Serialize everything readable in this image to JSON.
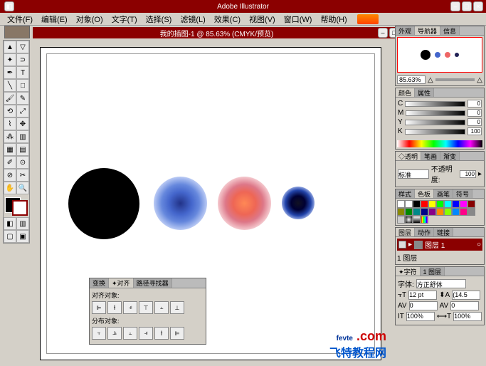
{
  "app": {
    "title": "Adobe Illustrator"
  },
  "menu": {
    "items": [
      "文件(F)",
      "编辑(E)",
      "对象(O)",
      "文字(T)",
      "选择(S)",
      "滤镜(L)",
      "效果(C)",
      "视图(V)",
      "窗口(W)",
      "帮助(H)"
    ]
  },
  "doc": {
    "title": "我的插图-1 @ 85.63% (CMYK/预览)"
  },
  "nav": {
    "tabs": [
      "外观",
      "导航器",
      "信息"
    ],
    "zoom": "85.63%"
  },
  "color": {
    "tabs": [
      "颜色",
      "属性"
    ],
    "channels": [
      "C",
      "M",
      "Y",
      "K"
    ],
    "vals": [
      "0",
      "0",
      "0",
      "100"
    ]
  },
  "trans": {
    "tabs": [
      "◇透明",
      "笔画",
      "渐变"
    ],
    "mode": "标准",
    "opacity_label": "不透明度:",
    "opacity": "100"
  },
  "swatches": {
    "tabs": [
      "样式",
      "色板",
      "画笔",
      "符号"
    ]
  },
  "layers": {
    "tabs": [
      "图层",
      "动作",
      "链接"
    ],
    "name": "图层 1",
    "count": "1 图层"
  },
  "align": {
    "tabs": [
      "变换",
      "✦对齐",
      "路径寻找器"
    ],
    "section1": "对齐对象:",
    "section2": "分布对象:"
  },
  "type": {
    "tabs": [
      "✦字符",
      "1 图层"
    ],
    "font_label": "字体:",
    "font": "方正舒体",
    "size": "12 pt",
    "leading": "(14.5",
    "kern": "0",
    "track": "0",
    "hscale": "100%",
    "vscale": "100%"
  },
  "watermark": {
    "p1": "fe",
    "p2": "vte",
    "p3": " .com",
    "sub": "飞特教程网"
  }
}
